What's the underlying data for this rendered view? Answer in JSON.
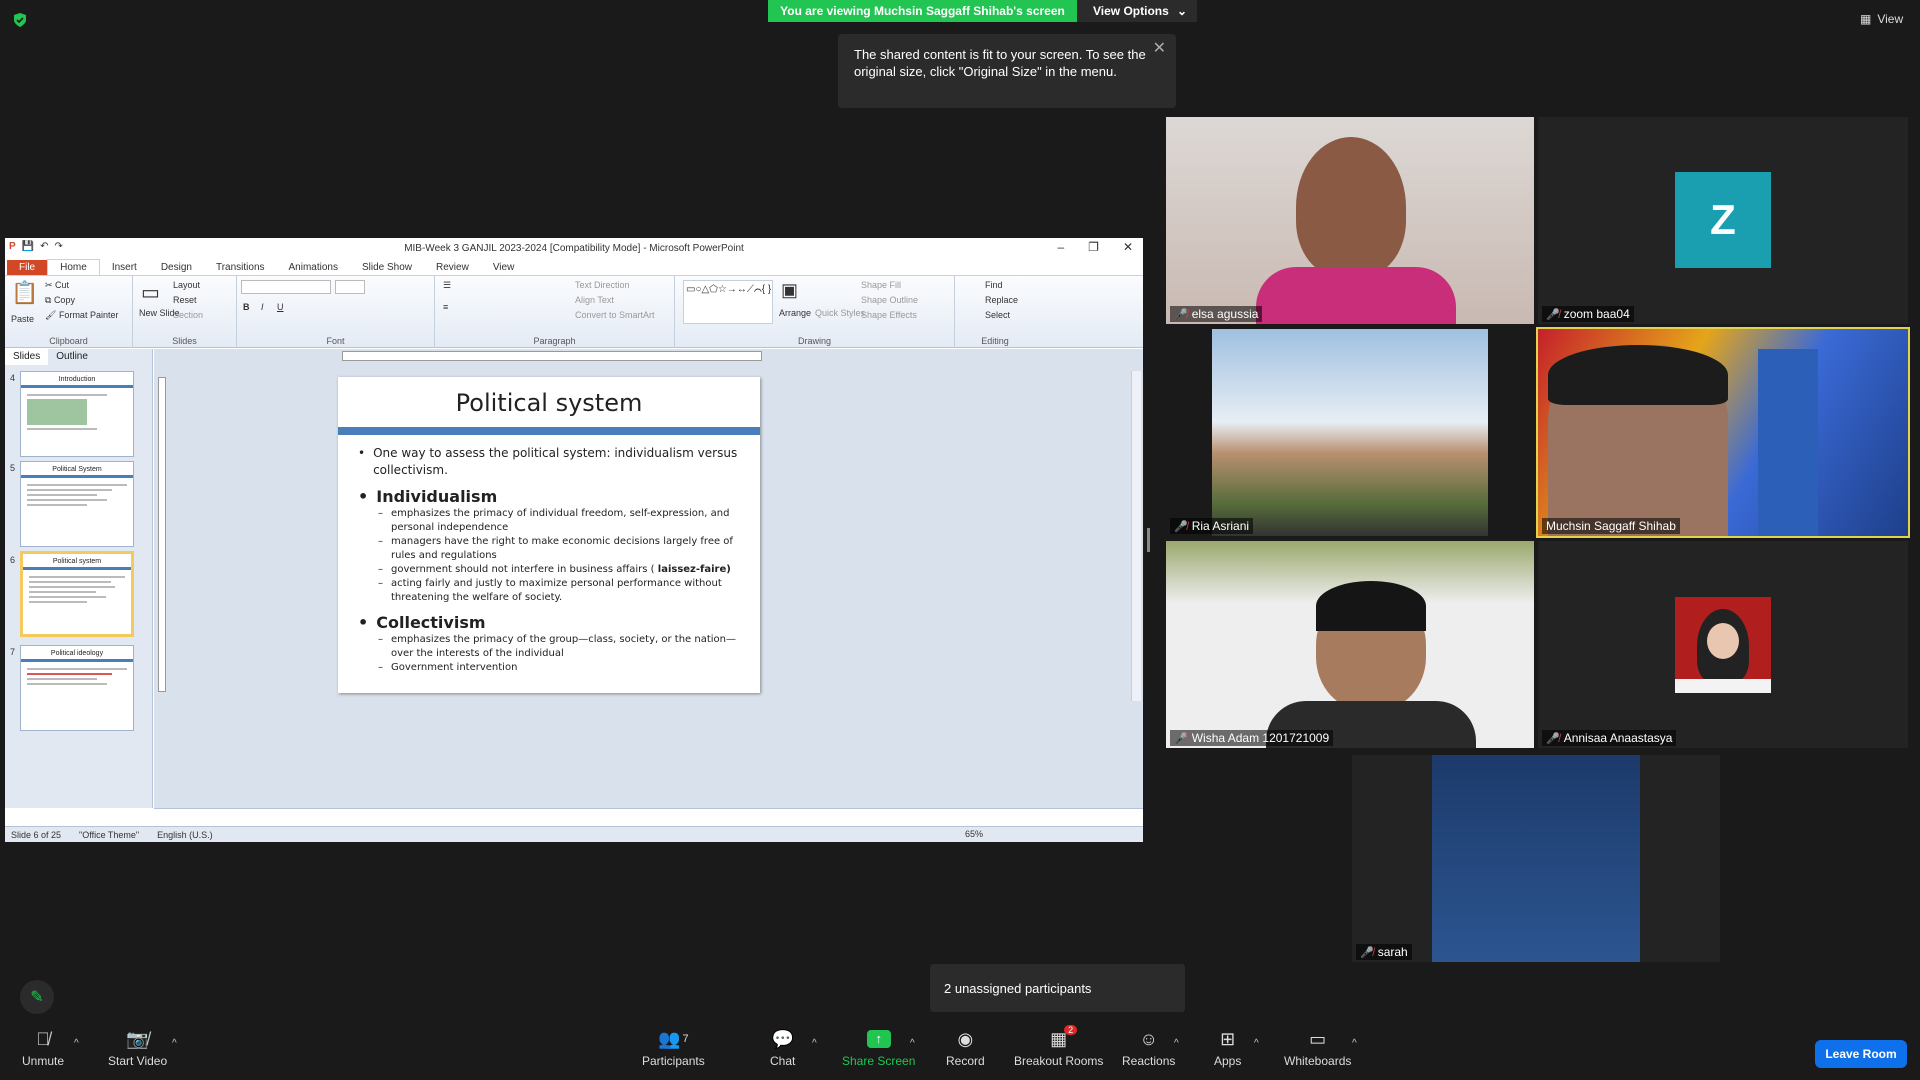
{
  "banner": {
    "text": "You are viewing Muchsin Saggaff Shihab's screen",
    "view_options": "View Options",
    "view_options_caret": "⌄"
  },
  "top_right": {
    "view": "View"
  },
  "tooltip": {
    "text": "The shared content is fit to your screen. To see the original size, click \"Original Size\" in the menu."
  },
  "ppt": {
    "title": "MIB-Week 3 GANJIL 2023-2024 [Compatibility Mode] - Microsoft PowerPoint",
    "tabs": [
      "File",
      "Home",
      "Insert",
      "Design",
      "Transitions",
      "Animations",
      "Slide Show",
      "Review",
      "View"
    ],
    "ribbon": {
      "clipboard": {
        "paste": "Paste",
        "cut": "Cut",
        "copy": "Copy",
        "format_painter": "Format Painter",
        "label": "Clipboard"
      },
      "slides": {
        "new_slide": "New Slide",
        "layout": "Layout",
        "reset": "Reset",
        "section": "Section",
        "label": "Slides"
      },
      "font": {
        "label": "Font"
      },
      "paragraph": {
        "text_direction": "Text Direction",
        "align_text": "Align Text",
        "convert": "Convert to SmartArt",
        "label": "Paragraph"
      },
      "drawing": {
        "arrange": "Arrange",
        "quick_styles": "Quick Styles",
        "shape_fill": "Shape Fill",
        "shape_outline": "Shape Outline",
        "shape_effects": "Shape Effects",
        "label": "Drawing"
      },
      "editing": {
        "find": "Find",
        "replace": "Replace",
        "select": "Select",
        "label": "Editing"
      }
    },
    "pane_tabs": {
      "slides": "Slides",
      "outline": "Outline"
    },
    "thumbnails": [
      {
        "num": "4",
        "title": "Introduction"
      },
      {
        "num": "5",
        "title": "Political System"
      },
      {
        "num": "6",
        "title": "Political system"
      },
      {
        "num": "7",
        "title": "Political ideology"
      }
    ],
    "slide": {
      "title": "Political system",
      "intro": "One way to assess the political system: individualism versus collectivism.",
      "h1": "Individualism",
      "ind_items": [
        "emphasizes the primacy of individual freedom, self-expression, and personal independence",
        "managers have the right to make economic decisions largely free of rules and regulations",
        "acting fairly and justly to maximize personal performance without threatening the welfare of society."
      ],
      "laissez_prefix": "government should not interfere in business affairs ( ",
      "laissez_bold": "laissez-faire)",
      "h2": "Collectivism",
      "col_items": [
        "emphasizes the primacy of the group—class, society, or the nation—over the interests of the individual",
        "Government intervention"
      ]
    },
    "status": {
      "slide": "Slide 6 of 25",
      "theme": "\"Office Theme\"",
      "lang": "English (U.S.)",
      "zoom": "65%"
    }
  },
  "participants_tiles": [
    {
      "name": "elsa agussia"
    },
    {
      "name": "zoom baa04",
      "initial": "Z"
    },
    {
      "name": "Ria Asriani"
    },
    {
      "name": "Muchsin Saggaff Shihab"
    },
    {
      "name": "Wisha Adam 1201721009"
    },
    {
      "name": "Annisaa Anaastasya"
    },
    {
      "name": "sarah"
    }
  ],
  "unassigned": "2 unassigned participants",
  "toolbar": {
    "unmute": "Unmute",
    "start_video": "Start Video",
    "participants": "Participants",
    "participants_count": "7",
    "chat": "Chat",
    "share": "Share Screen",
    "record": "Record",
    "breakout": "Breakout Rooms",
    "breakout_badge": "2",
    "reactions": "Reactions",
    "apps": "Apps",
    "whiteboards": "Whiteboards",
    "leave": "Leave Room"
  },
  "colors": {
    "share_green": "#23c552",
    "leave_blue": "#0e71eb",
    "slide_bar": "#4a7ebb",
    "active_speaker": "#e3d24b"
  }
}
